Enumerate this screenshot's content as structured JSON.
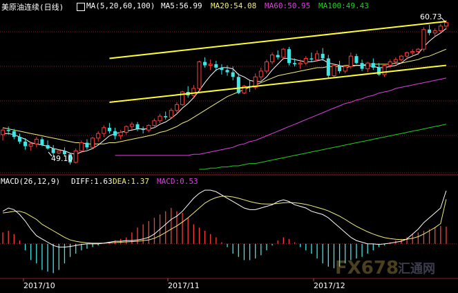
{
  "header": {
    "title": "美原油连续(日线)",
    "ma_params": "MA(5,20,60,100)",
    "ma5": "MA5:56.99",
    "ma20": "MA20:54.08",
    "ma60": "MA60:50.95",
    "ma100": "MA100:49.43"
  },
  "macd_header": {
    "params": "MACD(26,12,9)",
    "diff": "DIFF:1.63",
    "dea": "DEA:1.37",
    "macd": "MACD:0.53"
  },
  "annotations": {
    "high": "60.73",
    "low": "49.10"
  },
  "watermark": {
    "brand": "FX678",
    "cn": "汇通网"
  },
  "colors": {
    "up": "#ff3b3b",
    "down": "#41e6e6",
    "ma5": "#ffffff",
    "ma20": "#f2f07a",
    "ma60": "#e040e0",
    "ma100": "#20d020",
    "channel": "#ffff30",
    "grid": "#8a1f1f",
    "axis_text": "#ffffff"
  },
  "chart_data": {
    "type": "candlestick",
    "title": "美原油连续(日线)",
    "ylim": [
      47.5,
      61.5
    ],
    "dates_axis": [
      "2017/10",
      "2017/11",
      "2017/12"
    ],
    "candles": [
      [
        50.8,
        51.4,
        50.3,
        51.2
      ],
      [
        51.2,
        51.5,
        50.8,
        51.1
      ],
      [
        51.1,
        51.3,
        50.4,
        50.6
      ],
      [
        50.6,
        50.9,
        50.0,
        50.2
      ],
      [
        50.2,
        50.5,
        49.5,
        49.8
      ],
      [
        49.8,
        50.2,
        49.4,
        50.0
      ],
      [
        50.0,
        50.6,
        49.7,
        50.4
      ],
      [
        50.4,
        50.6,
        49.8,
        49.9
      ],
      [
        49.9,
        50.3,
        49.5,
        49.6
      ],
      [
        49.6,
        49.9,
        48.9,
        49.2
      ],
      [
        49.2,
        49.5,
        49.1,
        49.4
      ],
      [
        49.4,
        49.7,
        48.9,
        49.1
      ],
      [
        49.1,
        49.2,
        48.2,
        48.4
      ],
      [
        48.4,
        49.6,
        48.3,
        49.4
      ],
      [
        49.4,
        50.3,
        49.2,
        50.1
      ],
      [
        50.1,
        50.4,
        49.5,
        49.7
      ],
      [
        49.7,
        50.6,
        49.6,
        50.5
      ],
      [
        50.5,
        51.1,
        50.2,
        50.9
      ],
      [
        50.9,
        51.6,
        50.6,
        51.4
      ],
      [
        51.4,
        51.8,
        50.9,
        51.1
      ],
      [
        51.1,
        51.4,
        50.4,
        50.7
      ],
      [
        50.7,
        51.2,
        50.4,
        51.0
      ],
      [
        51.0,
        51.6,
        50.8,
        51.5
      ],
      [
        51.5,
        51.9,
        51.2,
        51.7
      ],
      [
        51.7,
        51.9,
        51.1,
        51.3
      ],
      [
        51.3,
        51.5,
        50.9,
        51.2
      ],
      [
        51.2,
        51.7,
        51.0,
        51.6
      ],
      [
        51.6,
        52.2,
        51.4,
        52.0
      ],
      [
        52.0,
        52.6,
        51.8,
        52.4
      ],
      [
        52.4,
        52.8,
        52.1,
        52.3
      ],
      [
        52.3,
        53.1,
        52.2,
        52.9
      ],
      [
        52.9,
        53.6,
        52.7,
        53.4
      ],
      [
        53.4,
        54.6,
        53.3,
        54.5
      ],
      [
        54.5,
        55.0,
        54.0,
        54.2
      ],
      [
        54.2,
        55.1,
        54.0,
        54.8
      ],
      [
        54.8,
        57.2,
        54.6,
        57.1
      ],
      [
        57.1,
        57.5,
        56.6,
        56.8
      ],
      [
        56.8,
        57.3,
        56.4,
        56.9
      ],
      [
        56.9,
        57.2,
        56.3,
        56.6
      ],
      [
        56.6,
        56.9,
        56.0,
        56.4
      ],
      [
        56.4,
        56.8,
        55.9,
        56.2
      ],
      [
        56.2,
        56.7,
        55.5,
        55.8
      ],
      [
        55.8,
        56.1,
        54.3,
        54.4
      ],
      [
        54.4,
        55.1,
        54.3,
        55.0
      ],
      [
        55.0,
        55.5,
        54.5,
        54.9
      ],
      [
        54.9,
        56.1,
        54.7,
        55.8
      ],
      [
        55.8,
        56.6,
        55.5,
        56.3
      ],
      [
        56.3,
        57.3,
        56.1,
        57.1
      ],
      [
        57.1,
        57.9,
        56.9,
        57.7
      ],
      [
        57.7,
        58.1,
        57.3,
        57.5
      ],
      [
        57.5,
        58.3,
        57.3,
        58.2
      ],
      [
        58.2,
        58.4,
        56.8,
        57.0
      ],
      [
        57.0,
        57.4,
        56.7,
        56.9
      ],
      [
        56.9,
        57.3,
        56.5,
        57.0
      ],
      [
        57.0,
        57.6,
        56.8,
        57.4
      ],
      [
        57.4,
        57.9,
        57.1,
        57.3
      ],
      [
        57.3,
        58.1,
        57.1,
        57.8
      ],
      [
        57.8,
        58.3,
        57.2,
        57.4
      ],
      [
        57.4,
        57.7,
        55.7,
        55.9
      ],
      [
        55.9,
        56.9,
        55.7,
        56.8
      ],
      [
        56.8,
        57.2,
        56.1,
        56.3
      ],
      [
        56.3,
        56.8,
        56.1,
        56.7
      ],
      [
        56.7,
        57.9,
        56.5,
        57.6
      ],
      [
        57.6,
        57.8,
        56.9,
        57.0
      ],
      [
        57.0,
        57.3,
        56.3,
        56.5
      ],
      [
        56.5,
        57.1,
        56.2,
        57.0
      ],
      [
        57.0,
        57.4,
        56.4,
        56.6
      ],
      [
        56.6,
        57.0,
        55.9,
        56.0
      ],
      [
        56.0,
        56.9,
        55.8,
        56.8
      ],
      [
        56.8,
        57.3,
        56.6,
        57.1
      ],
      [
        57.1,
        57.5,
        56.9,
        57.3
      ],
      [
        57.3,
        57.7,
        57.1,
        57.6
      ],
      [
        57.6,
        58.0,
        57.3,
        57.9
      ],
      [
        57.9,
        58.2,
        57.6,
        58.0
      ],
      [
        58.0,
        58.3,
        57.7,
        58.2
      ],
      [
        58.2,
        60.1,
        58.0,
        59.9
      ],
      [
        59.9,
        60.3,
        59.4,
        59.6
      ],
      [
        59.6,
        60.0,
        59.3,
        59.8
      ],
      [
        59.8,
        60.4,
        59.6,
        60.2
      ],
      [
        60.2,
        60.73,
        59.9,
        60.5
      ]
    ],
    "ma5": [
      50.9,
      50.9,
      50.8,
      50.6,
      50.4,
      50.1,
      50.0,
      49.9,
      49.8,
      49.6,
      49.5,
      49.4,
      49.2,
      49.1,
      49.3,
      49.4,
      49.6,
      49.9,
      50.3,
      50.7,
      50.9,
      51.0,
      51.1,
      51.2,
      51.3,
      51.3,
      51.3,
      51.4,
      51.7,
      51.9,
      52.2,
      52.6,
      53.1,
      53.5,
      54.0,
      54.6,
      55.3,
      55.9,
      56.4,
      56.6,
      56.6,
      56.5,
      56.0,
      55.8,
      55.5,
      55.4,
      55.4,
      55.8,
      56.4,
      56.9,
      57.4,
      57.4,
      57.3,
      57.2,
      57.1,
      57.1,
      57.2,
      57.3,
      57.0,
      56.9,
      56.8,
      56.6,
      56.7,
      56.8,
      56.8,
      56.8,
      56.7,
      56.6,
      56.6,
      56.7,
      56.8,
      57.0,
      57.4,
      57.6,
      57.8,
      58.4,
      58.9,
      59.3,
      59.6,
      60.0
    ],
    "ma20": [
      51.4,
      51.3,
      51.2,
      51.1,
      51.0,
      50.9,
      50.8,
      50.7,
      50.6,
      50.5,
      50.4,
      50.3,
      50.2,
      50.1,
      50.1,
      50.0,
      50.0,
      50.0,
      50.0,
      50.1,
      50.1,
      50.2,
      50.3,
      50.4,
      50.5,
      50.6,
      50.7,
      50.8,
      51.0,
      51.1,
      51.3,
      51.5,
      51.8,
      52.0,
      52.3,
      52.6,
      52.9,
      53.2,
      53.5,
      53.8,
      54.1,
      54.3,
      54.5,
      54.7,
      54.9,
      55.1,
      55.3,
      55.5,
      55.7,
      55.9,
      56.0,
      56.1,
      56.2,
      56.3,
      56.4,
      56.5,
      56.6,
      56.6,
      56.7,
      56.7,
      56.7,
      56.8,
      56.8,
      56.8,
      56.8,
      56.9,
      56.9,
      56.9,
      56.9,
      56.9,
      57.0,
      57.0,
      57.1,
      57.2,
      57.3,
      57.5,
      57.6,
      57.8,
      58.0,
      58.2
    ],
    "ma60": [
      49.0,
      49.0,
      49.0,
      49.0,
      49.0,
      49.0,
      49.0,
      49.0,
      49.0,
      49.0,
      49.0,
      49.0,
      49.0,
      49.0,
      49.1,
      49.1,
      49.2,
      49.3,
      49.4,
      49.5,
      49.6,
      49.7,
      49.9,
      50.0,
      50.2,
      50.3,
      50.5,
      50.7,
      50.9,
      51.1,
      51.3,
      51.5,
      51.7,
      51.9,
      52.1,
      52.3,
      52.5,
      52.7,
      52.9,
      53.1,
      53.3,
      53.5,
      53.6,
      53.8,
      53.9,
      54.1,
      54.2,
      54.4,
      54.5,
      54.6,
      54.8,
      54.9,
      55.0,
      55.1,
      55.2,
      55.3,
      55.4,
      55.5,
      55.6,
      55.7
    ],
    "ma60_start": 20,
    "ma100": [
      47.8,
      47.8,
      47.9,
      47.9,
      48.0,
      48.0,
      48.1,
      48.1,
      48.2,
      48.3,
      48.3,
      48.4,
      48.5,
      48.6,
      48.7,
      48.8,
      48.9,
      49.0,
      49.1,
      49.2,
      49.3,
      49.4,
      49.5,
      49.6,
      49.7,
      49.8,
      49.9,
      50.0,
      50.1,
      50.2,
      50.3,
      50.4,
      50.5,
      50.6,
      50.7,
      50.8,
      50.9,
      51.0,
      51.1,
      51.2,
      51.3,
      51.4,
      51.5,
      51.6,
      51.7
    ],
    "ma100_start": 35,
    "channel_upper": [
      [
        19,
        57.4
      ],
      [
        79,
        60.6
      ]
    ],
    "channel_lower": [
      [
        19,
        53.6
      ],
      [
        79,
        56.8
      ]
    ],
    "macd": {
      "ylim": [
        -1.0,
        1.8
      ],
      "diff": [
        1.0,
        1.1,
        1.05,
        0.9,
        0.7,
        0.45,
        0.25,
        0.15,
        0.05,
        -0.05,
        -0.1,
        -0.1,
        -0.08,
        -0.05,
        -0.02,
        0.0,
        0.0,
        0.0,
        0.02,
        0.05,
        0.08,
        0.08,
        0.1,
        0.1,
        0.12,
        0.15,
        0.2,
        0.3,
        0.45,
        0.6,
        0.75,
        0.85,
        1.0,
        1.2,
        1.4,
        1.55,
        1.65,
        1.65,
        1.6,
        1.5,
        1.4,
        1.3,
        1.2,
        1.1,
        1.05,
        1.05,
        1.1,
        1.15,
        1.2,
        1.3,
        1.35,
        1.3,
        1.2,
        1.15,
        1.1,
        1.0,
        0.95,
        0.9,
        0.8,
        0.65,
        0.5,
        0.35,
        0.2,
        0.1,
        0.05,
        0.0,
        0.0,
        -0.02,
        0.0,
        0.02,
        0.05,
        0.08,
        0.15,
        0.3,
        0.45,
        0.65,
        0.8,
        0.95,
        1.1,
        1.63
      ],
      "dea": [
        0.95,
        0.97,
        1.0,
        1.0,
        0.95,
        0.85,
        0.75,
        0.6,
        0.5,
        0.4,
        0.3,
        0.2,
        0.12,
        0.08,
        0.05,
        0.03,
        0.02,
        0.02,
        0.02,
        0.03,
        0.04,
        0.05,
        0.06,
        0.07,
        0.08,
        0.1,
        0.12,
        0.17,
        0.25,
        0.35,
        0.45,
        0.55,
        0.67,
        0.8,
        0.95,
        1.1,
        1.25,
        1.35,
        1.42,
        1.46,
        1.46,
        1.44,
        1.4,
        1.35,
        1.3,
        1.26,
        1.23,
        1.22,
        1.22,
        1.24,
        1.26,
        1.27,
        1.26,
        1.24,
        1.21,
        1.17,
        1.12,
        1.07,
        1.01,
        0.93,
        0.85,
        0.75,
        0.64,
        0.54,
        0.45,
        0.37,
        0.3,
        0.24,
        0.19,
        0.16,
        0.14,
        0.13,
        0.14,
        0.17,
        0.22,
        0.3,
        0.4,
        0.5,
        0.62,
        1.37
      ],
      "hist": [
        0.35,
        0.4,
        0.3,
        0.1,
        -0.2,
        -0.5,
        -0.6,
        -0.8,
        -0.85,
        -0.9,
        -0.8,
        -0.6,
        -0.4,
        -0.3,
        -0.2,
        -0.15,
        -0.1,
        -0.05,
        0.0,
        0.05,
        0.1,
        0.15,
        0.2,
        0.35,
        0.5,
        0.6,
        0.7,
        0.8,
        0.9,
        1.0,
        1.1,
        1.0,
        0.95,
        0.8,
        0.6,
        0.5,
        0.4,
        0.3,
        0.2,
        0.05,
        -0.1,
        -0.3,
        -0.4,
        -0.5,
        -0.5,
        -0.45,
        -0.35,
        -0.2,
        -0.05,
        0.1,
        0.2,
        0.15,
        0.05,
        -0.1,
        -0.2,
        -0.3,
        -0.45,
        -0.6,
        -0.7,
        -0.75,
        -0.7,
        -0.6,
        -0.5,
        -0.45,
        -0.4,
        -0.3,
        -0.2,
        -0.1,
        -0.05,
        0.05,
        0.1,
        0.15,
        0.2,
        0.3,
        0.35,
        0.4,
        0.45,
        0.5,
        0.55,
        0.53
      ]
    }
  }
}
